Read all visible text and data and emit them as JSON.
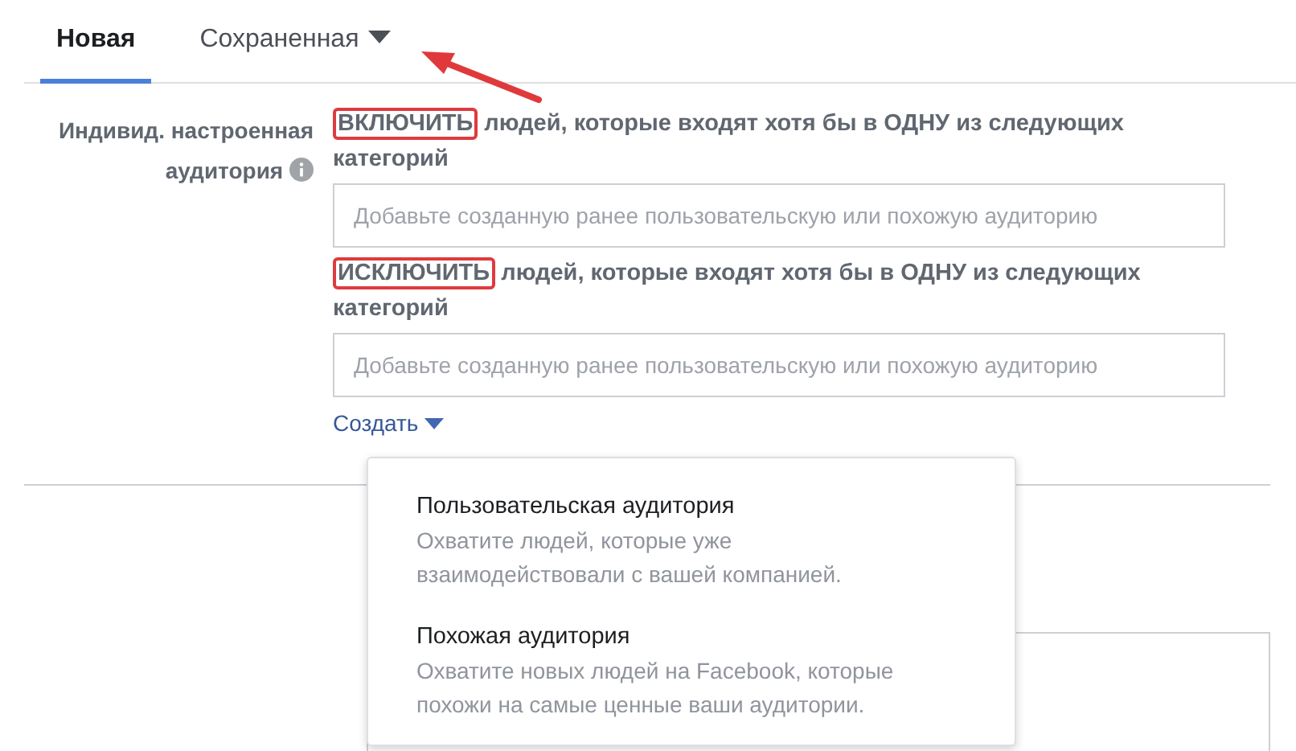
{
  "tabs": [
    {
      "label": "Новая",
      "selected": true,
      "has_caret": false
    },
    {
      "label": "Сохраненная",
      "selected": false,
      "has_caret": true
    }
  ],
  "audience": {
    "label": "Индивид. настроенная аудитория",
    "conditions": [
      {
        "keyword": "ВКЛЮЧИТЬ",
        "highlighted": true,
        "text": "людей, которые входят хотя бы в ОДНУ из следующих категорий",
        "placeholder": "Добавьте созданную ранее пользовательскую или похожую аудиторию"
      },
      {
        "keyword": "ИСКЛЮЧИТЬ",
        "highlighted": true,
        "text": "людей, которые входят хотя бы в ОДНУ из следующих категорий",
        "placeholder": "Добавьте созданную ранее пользовательскую или похожую аудиторию"
      }
    ],
    "create_link": "Создать"
  },
  "create_menu": {
    "expanded": true,
    "items": [
      {
        "title": "Пользовательская аудитория",
        "description": "Охватите людей, которые уже взаимодействовали с вашей компанией."
      },
      {
        "title": "Похожая аудитория",
        "description": "Охватите новых людей на Facebook, которые похожи на самые ценные ваши аудитории."
      }
    ]
  }
}
